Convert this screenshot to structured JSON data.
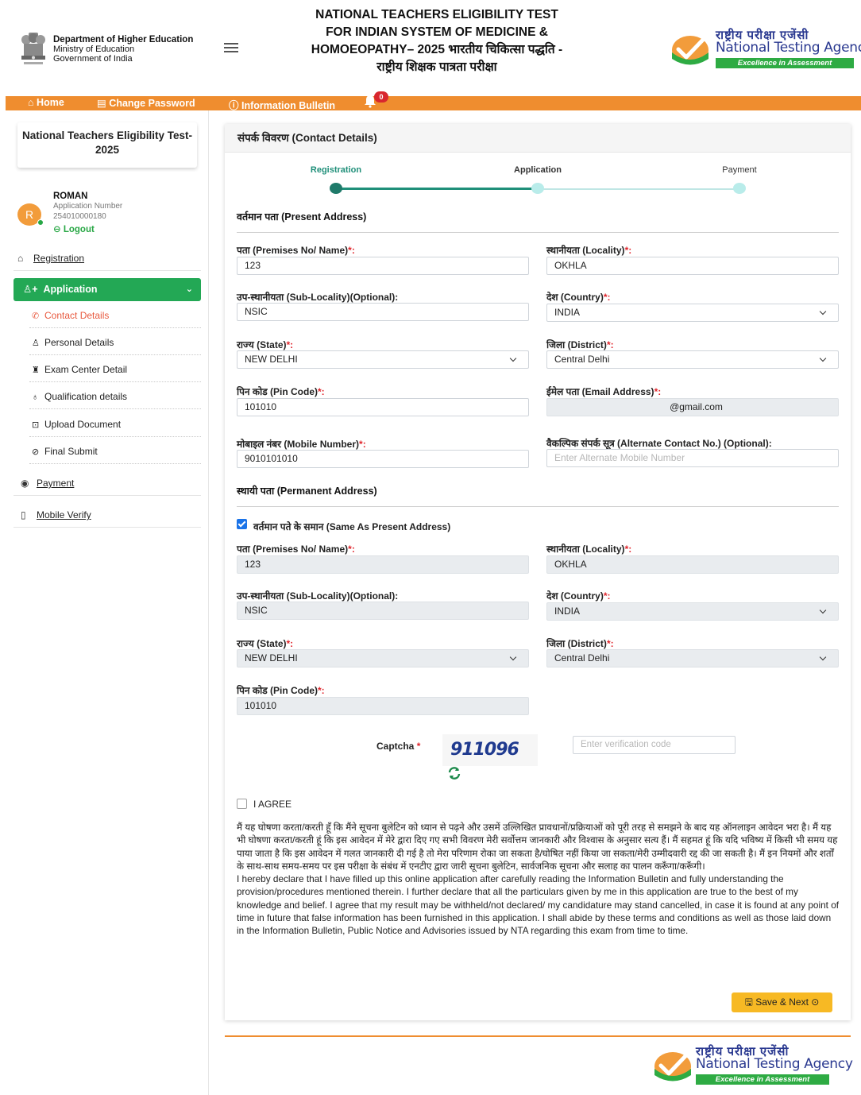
{
  "header": {
    "dept_line1": "Department of Higher Education",
    "dept_line2": "Ministry of Education",
    "dept_line3": "Government of India",
    "exam_title": "NATIONAL TEACHERS ELIGIBILITY TEST FOR INDIAN SYSTEM OF MEDICINE & HOMOEOPATHY– 2025 भारतीय चिकित्सा पद्धति - राष्ट्रीय शिक्षक पात्रता परीक्षा",
    "nta_hindi": "राष्ट्रीय परीक्षा एजेंसी",
    "nta_english": "National Testing Agency",
    "nta_tagline": "Excellence in Assessment"
  },
  "nav": {
    "home": "Home",
    "change_password": "Change Password",
    "info_bulletin": "Information Bulletin",
    "notification_count": "0"
  },
  "sidebar": {
    "exam_name": "National Teachers Eligibility Test-2025",
    "avatar_letter": "R",
    "user_name": "ROMAN",
    "app_number_label": "Application Number",
    "app_number": "254010000180",
    "logout": "Logout",
    "registration": "Registration",
    "application": "Application",
    "sub_items": [
      "Contact Details",
      "Personal Details",
      "Exam Center Detail",
      "Qualification details",
      "Upload Document",
      "Final Submit"
    ],
    "payment": "Payment",
    "mobile_verify": "Mobile Verify"
  },
  "main": {
    "title": "संपर्क विवरण (Contact Details)",
    "steps": [
      "Registration",
      "Application",
      "Payment"
    ],
    "present_title": "वर्तमान पता (Present Address)",
    "permanent_title": "स्थायी पता (Permanent Address)",
    "same_as_present": "वर्तमान पते के समान (Same As Present Address)",
    "labels": {
      "premises": "पता (Premises No/ Name)",
      "locality": "स्थानीयता (Locality)",
      "sub_locality": "उप-स्थानीयता (Sub-Locality)(Optional):",
      "country": "देश (Country)",
      "state": "राज्य (State)",
      "district": "जिला (District)",
      "pin": "पिन कोड (Pin Code)",
      "email": "ईमेल पता (Email Address)",
      "mobile": "मोबाइल नंबर (Mobile Number)",
      "alt_contact": "वैकल्पिक संपर्क सूत्र (Alternate Contact No.) (Optional):",
      "required_suffix": "*:"
    },
    "present": {
      "premises": "123",
      "locality": "OKHLA",
      "sub_locality": "NSIC",
      "country": "INDIA",
      "state": "NEW DELHI",
      "district": "Central Delhi",
      "pin": "101010",
      "email": "@gmail.com",
      "mobile": "9010101010",
      "alt_placeholder": "Enter Alternate Mobile Number"
    },
    "permanent": {
      "premises": "123",
      "locality": "OKHLA",
      "sub_locality": "NSIC",
      "country": "INDIA",
      "state": "NEW DELHI",
      "district": "Central Delhi",
      "pin": "101010"
    },
    "captcha_label": "Captcha",
    "captcha_required": "*",
    "captcha_text": "911096",
    "captcha_placeholder": "Enter verification code",
    "agree": "I AGREE",
    "declaration_hindi": "मैं यह घोषणा करता/करती हूँ कि मैंने सूचना बुलेटिन को ध्यान से पढ़ने और उसमें उल्लिखित प्रावधानों/प्रक्रियाओं को पूरी तरह से समझने के बाद यह ऑनलाइन आवेदन भरा है। मैं यह भी घोषणा करता/करती हूं कि इस आवेदन में मेरे द्वारा दिए गए सभी विवरण मेरी सर्वोत्तम जानकारी और विश्वास के अनुसार सत्य हैं। मैं सहमत हूं कि यदि भविष्य में किसी भी समय यह पाया जाता है कि इस आवेदन में गलत जानकारी दी गई है तो मेरा परिणाम रोका जा सकता है/घोषित नहीं किया जा सकता/मेरी उम्मीदवारी रद्द की जा सकती है। मैं इन नियमों और शर्तों के साथ-साथ समय-समय पर इस परीक्षा के संबंध में एनटीए द्वारा जारी सूचना बुलेटिन, सार्वजनिक सूचना और सलाह का पालन करूँगा/करूँगी।",
    "declaration_english": "I hereby declare that I have filled up this online application after carefully reading the Information Bulletin and fully understanding the provision/procedures mentioned therein. I further declare that all the particulars given by me in this application are true to the best of my knowledge and belief. I agree that my result may be withheld/not declared/ my candidature may stand cancelled, in case it is found at any point of time in future that false information has been furnished in this application. I shall abide by these terms and conditions as well as those laid down in the Information Bulletin, Public Notice and Advisories issued by NTA regarding this exam from time to time.",
    "save_next": "Save & Next"
  },
  "colors": {
    "nav_orange": "#ef8d2f",
    "active_green": "#23a855",
    "step_teal": "#1f8f79",
    "nta_blue": "#2a3990",
    "save_yellow": "#f7b924",
    "link_red": "#e8593e"
  },
  "icons": {
    "home": "home-icon",
    "lock": "lock-icon",
    "info": "info-icon",
    "bell": "bell-icon",
    "refresh": "refresh-icon",
    "save": "save-icon"
  }
}
